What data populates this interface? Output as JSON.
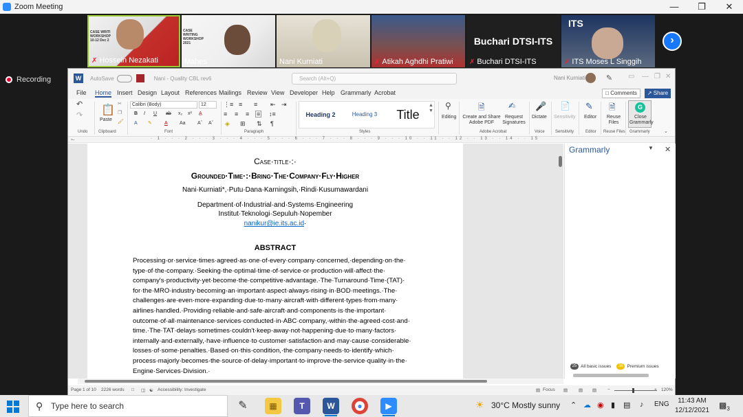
{
  "zoom": {
    "title": "Zoom Meeting",
    "participants": [
      {
        "name": "Hossein Nezakati",
        "muted": true
      },
      {
        "name": "Mahes",
        "muted": false
      },
      {
        "name": "Nani Kurniati",
        "muted": false
      },
      {
        "name": "Atikah Aghdhi Pratiwi",
        "muted": true
      },
      {
        "name": "Buchari DTSI-ITS",
        "muted": true,
        "display_name": "Buchari DTSI-ITS"
      },
      {
        "name": "ITS Moses L Singgih",
        "muted": true
      }
    ],
    "recording_label": "Recording"
  },
  "word": {
    "autosave_label": "AutoSave",
    "autosave_state": "Off",
    "doc_name": "Nani - Quality CBL rev6",
    "search_placeholder": "Search (Alt+Q)",
    "user_name": "Nani Kurniati",
    "tabs": [
      "File",
      "Home",
      "Insert",
      "Design",
      "Layout",
      "References",
      "Mailings",
      "Review",
      "View",
      "Developer",
      "Help",
      "Grammarly",
      "Acrobat"
    ],
    "active_tab": "Home",
    "comments_label": "Comments",
    "share_label": "Share",
    "ribbon": {
      "undo": "Undo",
      "paste": "Paste",
      "clipboard": "Clipboard",
      "font_name": "Calibri (Body)",
      "font_size": "12",
      "font": "Font",
      "paragraph": "Paragraph",
      "styles": "Styles",
      "style_items": [
        "Heading 2",
        "Heading 3",
        "Title"
      ],
      "editing": "Editing",
      "create_share": "Create and Share Adobe PDF",
      "request_signatures": "Request Signatures",
      "adobe_acrobat": "Adobe Acrobat",
      "dictate": "Dictate",
      "voice": "Voice",
      "sensitivity": "Sensitivity",
      "editor": "Editor",
      "reuse_files": "Reuse Files",
      "close_grammarly": "Close Grammarly",
      "grammarly": "Grammarly"
    },
    "document": {
      "case_title": "Case·title·:·",
      "title": "Grounded·Time·:·Bring·The·Company·Fly·Higher",
      "authors": "Nani·Kurniati*,·Putu·Dana·Karningsih,·Rindi·Kusumawardani",
      "department": "Department·of·Industrial·and·Systems·Engineering",
      "institute": "Institut·Teknologi·Sepuluh·Nopember",
      "email": "nanikur@ie.its.ac.id",
      "abstract_heading": "ABSTRACT",
      "abstract_lines": [
        "Processing·or·service·times·agreed·as·one·of·every·company·concerned,·depending·on·the·",
        "type·of·the·company.·Seeking·the·optimal·time·of·service·or·production·will·affect·the·",
        "company's·productivity·yet·become·the·competitive·advantage.·The·Turnaround·Time·(TAT)·",
        "for·the·MRO·industry·becoming·an·important·aspect·always·rising·in·BOD·meetings.·The·",
        "challenges·are·even·more·expanding·due·to·many·aircraft·with·different·types·from·many·",
        "airlines·handled.·Providing·reliable·and·safe·aircraft·and·components·is·the·important·",
        "outcome·of·all·maintenance·services·conducted·in·ABC·company,·within·the·agreed·cost·and·",
        "time.·The·TAT·delays·sometimes·couldn't·keep·away·not·happening·due·to·many·factors·",
        "internally·and·externally,·have·influence·to·customer·satisfaction·and·may·cause·considerable·",
        "losses·of·some·penalties.·Based·on·this·condition,·the·company·needs·to·identify·which·",
        "process·majorly·becomes·the·source·of·delay·important·to·improve·the·service·quality·in·the·",
        "Engine·Services·Division.·"
      ]
    },
    "grammarly_panel": {
      "title": "Grammarly",
      "basic_count": "25",
      "basic_label": "All basic issues",
      "premium_count": "36",
      "premium_label": "Premium issues"
    },
    "status": {
      "page": "Page 1 of 10",
      "words": "2226 words",
      "accessibility": "Accessibility: Investigate",
      "focus": "Focus",
      "zoom": "120%"
    }
  },
  "taskbar": {
    "search_placeholder": "Type here to search",
    "weather": "30°C  Mostly sunny",
    "lang": "ENG",
    "time": "11:43 AM",
    "date": "12/12/2021",
    "notifications": "3"
  },
  "colors": {
    "word_blue": "#2b579a",
    "zoom_blue": "#2d8cff",
    "recording_red": "#e00033"
  }
}
